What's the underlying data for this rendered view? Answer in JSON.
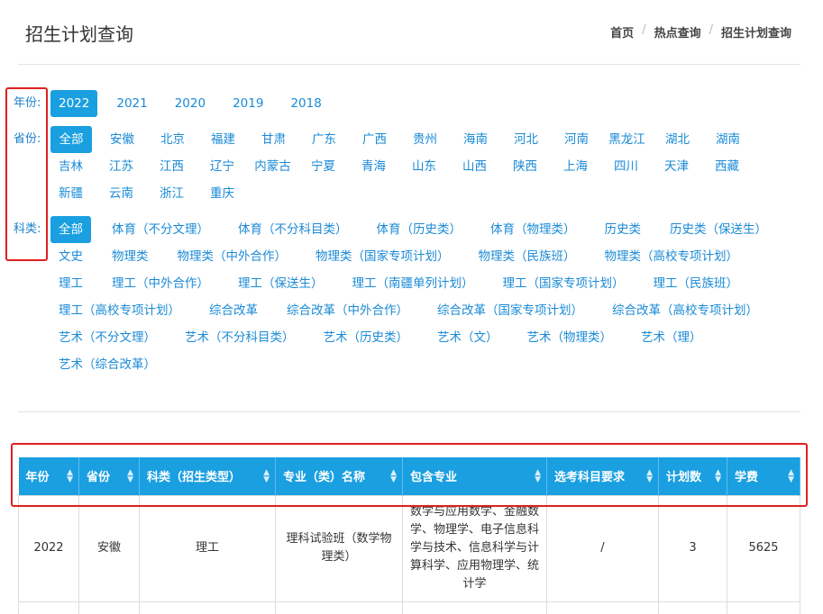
{
  "header": {
    "title": "招生计划查询",
    "breadcrumb": [
      "首页",
      "热点查询",
      "招生计划查询"
    ]
  },
  "filters": {
    "year": {
      "label": "年份:",
      "items": [
        "2022",
        "2021",
        "2020",
        "2019",
        "2018"
      ],
      "selected": "2022"
    },
    "province": {
      "label": "省份:",
      "items": [
        "全部",
        "安徽",
        "北京",
        "福建",
        "甘肃",
        "广东",
        "广西",
        "贵州",
        "海南",
        "河北",
        "河南",
        "黑龙江",
        "湖北",
        "湖南",
        "吉林",
        "江苏",
        "江西",
        "辽宁",
        "内蒙古",
        "宁夏",
        "青海",
        "山东",
        "山西",
        "陕西",
        "上海",
        "四川",
        "天津",
        "西藏",
        "新疆",
        "云南",
        "浙江",
        "重庆"
      ],
      "selected": "全部"
    },
    "category": {
      "label": "科类:",
      "items": [
        "全部",
        "体育（不分文理）",
        "体育（不分科目类）",
        "体育（历史类）",
        "体育（物理类）",
        "历史类",
        "历史类（保送生）",
        "文史",
        "物理类",
        "物理类（中外合作）",
        "物理类（国家专项计划）",
        "物理类（民族班）",
        "物理类（高校专项计划）",
        "理工",
        "理工（中外合作）",
        "理工（保送生）",
        "理工（南疆单列计划）",
        "理工（国家专项计划）",
        "理工（民族班）",
        "理工（高校专项计划）",
        "综合改革",
        "综合改革（中外合作）",
        "综合改革（国家专项计划）",
        "综合改革（高校专项计划）",
        "艺术（不分文理）",
        "艺术（不分科目类）",
        "艺术（历史类）",
        "艺术（文）",
        "艺术（物理类）",
        "艺术（理）",
        "艺术（综合改革）"
      ],
      "selected": "全部"
    }
  },
  "table": {
    "columns": [
      "年份",
      "省份",
      "科类（招生类型）",
      "专业（类）名称",
      "包含专业",
      "选考科目要求",
      "计划数",
      "学费"
    ],
    "rows": [
      [
        "2022",
        "安徽",
        "理工",
        "理科试验班（数学物理类）",
        "数学与应用数学、金融数学、物理学、电子信息科学与技术、信息科学与计算科学、应用物理学、统计学",
        "/",
        "3",
        "5625"
      ],
      [
        "",
        "",
        "",
        "",
        "",
        "",
        "",
        ""
      ]
    ]
  },
  "colors": {
    "accent": "#1a9fe0",
    "link": "#1a8ad6",
    "highlight_box": "#e02020"
  }
}
